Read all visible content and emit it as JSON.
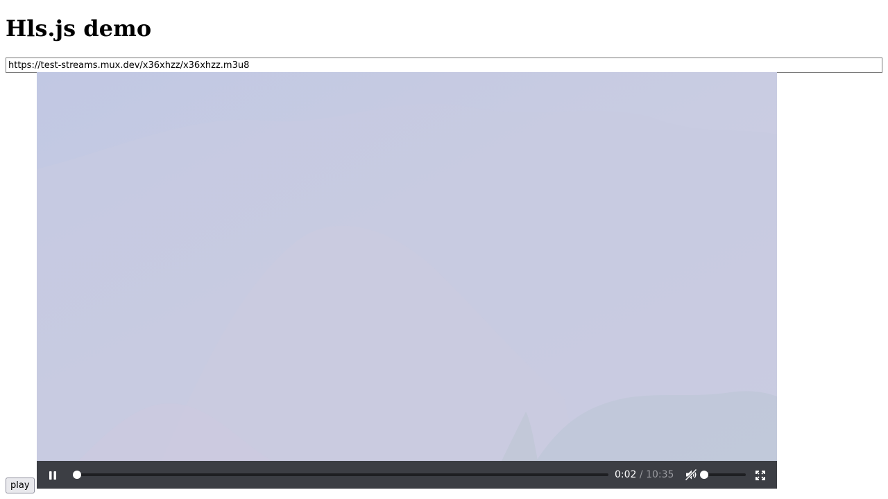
{
  "page": {
    "title": "Hls.js demo"
  },
  "source": {
    "url": "https://test-streams.mux.dev/x36xhzz/x36xhzz.m3u8"
  },
  "player": {
    "state": "playing",
    "current_time": "0:02",
    "separator": "/",
    "duration": "10:35",
    "progress_fraction": 0.003,
    "muted": true,
    "volume_fraction": 0.0,
    "icons": {
      "pause": "pause-icon",
      "mute": "volume-muted-icon",
      "fullscreen": "fullscreen-icon"
    }
  },
  "buttons": {
    "play_label": "play"
  },
  "colors": {
    "video_tint": "#c9cde2",
    "controls_bg": "#3c3e44",
    "controls_fg": "#ffffff"
  }
}
